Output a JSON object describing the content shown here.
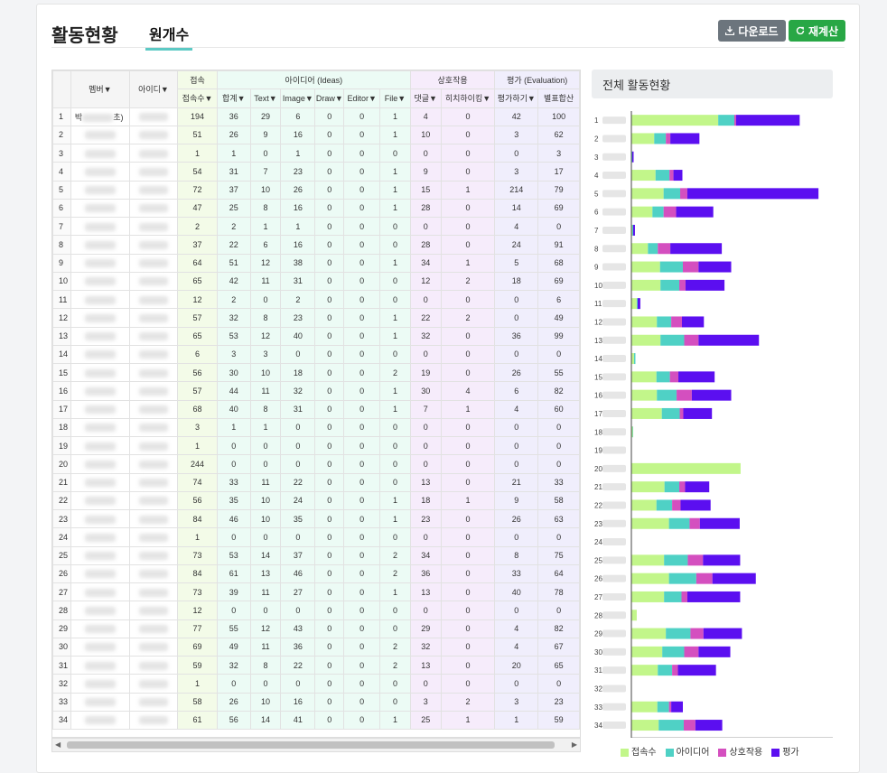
{
  "header": {
    "title": "활동현황",
    "tab_label": "원개수",
    "download_label": "다운로드",
    "recalc_label": "재계산"
  },
  "table": {
    "group_headers": {
      "member": "멤버▼",
      "id": "아이디▼",
      "access": "접속",
      "ideas": "아이디어 (Ideas)",
      "interaction": "상호작용",
      "evaluation": "평가 (Evaluation)"
    },
    "sub_headers": {
      "access_count": "접속수▼",
      "total": "합계▼",
      "text": "Text▼",
      "image": "Image▼",
      "draw": "Draw▼",
      "editor": "Editor▼",
      "file": "File▼",
      "comment": "댓글▼",
      "hichi": "히치하이킹▼",
      "eval_do": "평가하기▼",
      "eval_pub": "별표합산"
    },
    "first_member_visible": "박",
    "first_member_suffix": "초)",
    "rows": [
      [
        1,
        194,
        36,
        29,
        6,
        0,
        0,
        1,
        4,
        0,
        42,
        100
      ],
      [
        2,
        51,
        26,
        9,
        16,
        0,
        0,
        1,
        10,
        0,
        3,
        62
      ],
      [
        3,
        1,
        1,
        0,
        1,
        0,
        0,
        0,
        0,
        0,
        0,
        3
      ],
      [
        4,
        54,
        31,
        7,
        23,
        0,
        0,
        1,
        9,
        0,
        3,
        17
      ],
      [
        5,
        72,
        37,
        10,
        26,
        0,
        0,
        1,
        15,
        1,
        214,
        79
      ],
      [
        6,
        47,
        25,
        8,
        16,
        0,
        0,
        1,
        28,
        0,
        14,
        69
      ],
      [
        7,
        2,
        2,
        1,
        1,
        0,
        0,
        0,
        0,
        0,
        4,
        0
      ],
      [
        8,
        37,
        22,
        6,
        16,
        0,
        0,
        0,
        28,
        0,
        24,
        91
      ],
      [
        9,
        64,
        51,
        12,
        38,
        0,
        0,
        1,
        34,
        1,
        5,
        68
      ],
      [
        10,
        65,
        42,
        11,
        31,
        0,
        0,
        0,
        12,
        2,
        18,
        69
      ],
      [
        11,
        12,
        2,
        0,
        2,
        0,
        0,
        0,
        0,
        0,
        0,
        6
      ],
      [
        12,
        57,
        32,
        8,
        23,
        0,
        0,
        1,
        22,
        2,
        0,
        49
      ],
      [
        13,
        65,
        53,
        12,
        40,
        0,
        0,
        1,
        32,
        0,
        36,
        99
      ],
      [
        14,
        6,
        3,
        3,
        0,
        0,
        0,
        0,
        0,
        0,
        0,
        0
      ],
      [
        15,
        56,
        30,
        10,
        18,
        0,
        0,
        2,
        19,
        0,
        26,
        55
      ],
      [
        16,
        57,
        44,
        11,
        32,
        0,
        0,
        1,
        30,
        4,
        6,
        82
      ],
      [
        17,
        68,
        40,
        8,
        31,
        0,
        0,
        1,
        7,
        1,
        4,
        60
      ],
      [
        18,
        3,
        1,
        1,
        0,
        0,
        0,
        0,
        0,
        0,
        0,
        0
      ],
      [
        19,
        1,
        0,
        0,
        0,
        0,
        0,
        0,
        0,
        0,
        0,
        0
      ],
      [
        20,
        244,
        0,
        0,
        0,
        0,
        0,
        0,
        0,
        0,
        0,
        0
      ],
      [
        21,
        74,
        33,
        11,
        22,
        0,
        0,
        0,
        13,
        0,
        21,
        33
      ],
      [
        22,
        56,
        35,
        10,
        24,
        0,
        0,
        1,
        18,
        1,
        9,
        58
      ],
      [
        23,
        84,
        46,
        10,
        35,
        0,
        0,
        1,
        23,
        0,
        26,
        63
      ],
      [
        24,
        1,
        0,
        0,
        0,
        0,
        0,
        0,
        0,
        0,
        0,
        0
      ],
      [
        25,
        73,
        53,
        14,
        37,
        0,
        0,
        2,
        34,
        0,
        8,
        75
      ],
      [
        26,
        84,
        61,
        13,
        46,
        0,
        0,
        2,
        36,
        0,
        33,
        64
      ],
      [
        27,
        73,
        39,
        11,
        27,
        0,
        0,
        1,
        13,
        0,
        40,
        78
      ],
      [
        28,
        12,
        0,
        0,
        0,
        0,
        0,
        0,
        0,
        0,
        0,
        0
      ],
      [
        29,
        77,
        55,
        12,
        43,
        0,
        0,
        0,
        29,
        0,
        4,
        82
      ],
      [
        30,
        69,
        49,
        11,
        36,
        0,
        0,
        2,
        32,
        0,
        4,
        67
      ],
      [
        31,
        59,
        32,
        8,
        22,
        0,
        0,
        2,
        13,
        0,
        20,
        65
      ],
      [
        32,
        1,
        0,
        0,
        0,
        0,
        0,
        0,
        0,
        0,
        0,
        0
      ],
      [
        33,
        58,
        26,
        10,
        16,
        0,
        0,
        0,
        3,
        2,
        3,
        23
      ],
      [
        34,
        61,
        56,
        14,
        41,
        0,
        0,
        1,
        25,
        1,
        1,
        59
      ]
    ]
  },
  "chart_panel": {
    "title": "전체 활동현황"
  },
  "chart_data": {
    "type": "bar",
    "orientation": "horizontal",
    "stacked": true,
    "categories": [
      "1",
      "2",
      "3",
      "4",
      "5",
      "6",
      "7",
      "8",
      "9",
      "10",
      "11",
      "12",
      "13",
      "14",
      "15",
      "16",
      "17",
      "18",
      "19",
      "20",
      "21",
      "22",
      "23",
      "24",
      "25",
      "26",
      "27",
      "28",
      "29",
      "30",
      "31",
      "32",
      "33",
      "34"
    ],
    "series": [
      {
        "name": "접속수",
        "color": "#c2f68a",
        "values": [
          194,
          51,
          1,
          54,
          72,
          47,
          2,
          37,
          64,
          65,
          12,
          57,
          65,
          6,
          56,
          57,
          68,
          3,
          1,
          244,
          74,
          56,
          84,
          1,
          73,
          84,
          73,
          12,
          77,
          69,
          59,
          1,
          58,
          61
        ]
      },
      {
        "name": "아이디어",
        "color": "#4fd1c5",
        "values": [
          36,
          26,
          1,
          31,
          37,
          25,
          2,
          22,
          51,
          42,
          2,
          32,
          53,
          3,
          30,
          44,
          40,
          1,
          0,
          0,
          33,
          35,
          46,
          0,
          53,
          61,
          39,
          0,
          55,
          49,
          32,
          0,
          26,
          56
        ]
      },
      {
        "name": "상호작용",
        "color": "#d44fbf",
        "values": [
          4,
          10,
          0,
          9,
          16,
          28,
          0,
          28,
          35,
          14,
          0,
          24,
          32,
          0,
          19,
          34,
          8,
          0,
          0,
          0,
          13,
          19,
          23,
          0,
          34,
          36,
          13,
          0,
          29,
          32,
          13,
          0,
          5,
          26
        ]
      },
      {
        "name": "평가",
        "color": "#5b0ff0",
        "values": [
          142,
          65,
          3,
          20,
          293,
          83,
          4,
          115,
          73,
          87,
          6,
          49,
          135,
          0,
          81,
          88,
          64,
          0,
          0,
          0,
          54,
          67,
          89,
          0,
          83,
          97,
          118,
          0,
          86,
          71,
          85,
          0,
          26,
          60
        ]
      }
    ],
    "xlim": [
      0,
      450
    ],
    "xticks": [
      0,
      50,
      100,
      150,
      200,
      250,
      300,
      350,
      400,
      450
    ],
    "legend_position": "bottom"
  }
}
